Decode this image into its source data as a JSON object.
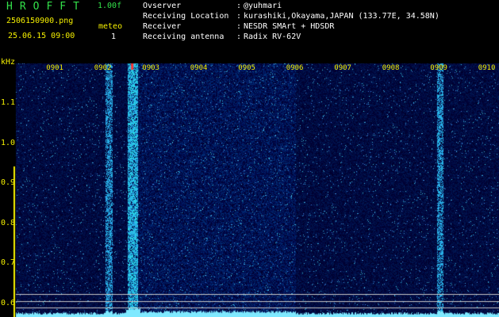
{
  "header": {
    "app_name": "HROFFT",
    "version": "1.00f",
    "file_name": "2506150900.png",
    "timestamp": "25.06.15 09:00",
    "meteor_label": "meteor",
    "meteor_count": "1"
  },
  "station": [
    {
      "label": "Ovserver",
      "value": "@yuhmari"
    },
    {
      "label": "Receiving Location",
      "value": "kurashiki,Okayama,JAPAN (133.77E, 34.58N)"
    },
    {
      "label": "Receiver",
      "value": "NESDR SMArt + HDSDR"
    },
    {
      "label": "Receiving antenna",
      "value": "Radix RV-62V"
    }
  ],
  "colors": {
    "title": "#33e04a",
    "labels": "#f5f000",
    "meta_text": "#ffffff",
    "spectrogram_background": "#000070",
    "signal": "#7fe9ff"
  },
  "chart_data": {
    "type": "heatmap",
    "xlabel": "",
    "ylabel": "kHz",
    "y_unit_label": "kHz",
    "y_ticks": [
      1.1,
      1.0,
      0.9,
      0.8,
      0.7,
      0.6
    ],
    "y_tick_labels": [
      "1.1",
      "1.0",
      "0.9",
      "0.8",
      "0.7",
      "0.6"
    ],
    "ylim": [
      0.59,
      1.19
    ],
    "x_tick_labels": [
      "0901",
      "0902",
      "0903",
      "0904",
      "0905",
      "0906",
      "0907",
      "0908",
      "0909",
      "0910"
    ],
    "xlim_minutes": [
      0,
      10
    ],
    "reference_lines_khz": [
      0.623,
      0.605,
      0.59
    ],
    "vertical_bands": [
      {
        "minute": 1.9,
        "width_min": 0.08,
        "strength": 0.55
      },
      {
        "minute": 2.4,
        "width_min": 0.15,
        "strength": 1.0
      },
      {
        "minute": 8.8,
        "width_min": 0.07,
        "strength": 0.6
      }
    ],
    "meteor_marker_minute": 2.4,
    "noise_region_minutes": [
      2.3,
      5.8
    ]
  }
}
